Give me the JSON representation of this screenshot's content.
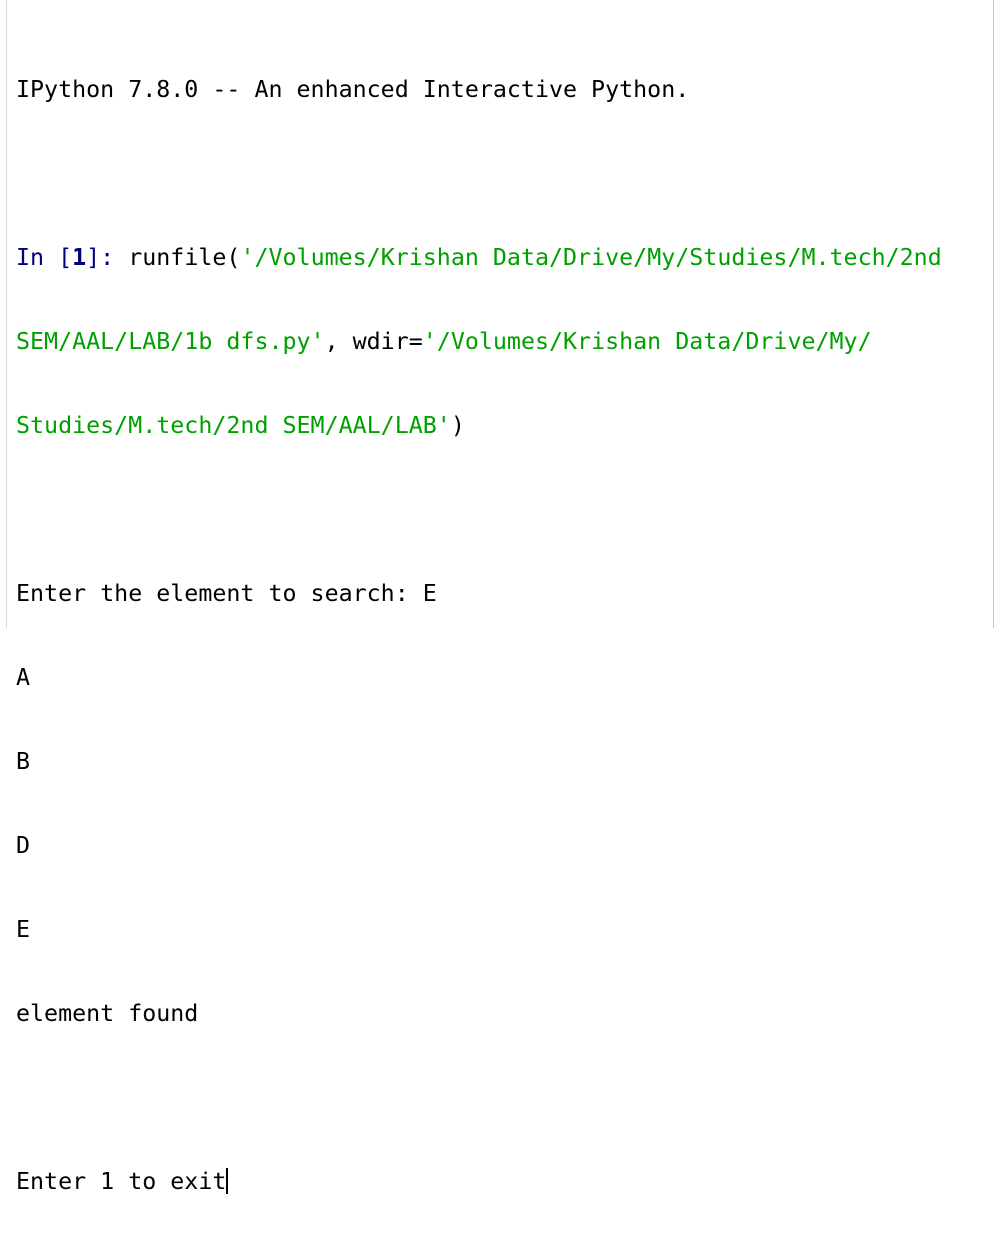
{
  "banner": "IPython 7.8.0 -- An enhanced Interactive Python.",
  "input": {
    "prompt_prefix": "In [",
    "prompt_number": "1",
    "prompt_suffix": "]: ",
    "line1_code": "runfile(",
    "line1_str": "'/Volumes/Krishan Data/Drive/My/Studies/M.tech/2nd",
    "line2_str": "SEM/AAL/LAB/1b dfs.py'",
    "line2_code": ", wdir=",
    "line2_str2": "'/Volumes/Krishan Data/Drive/My/",
    "line3_str": "Studies/M.tech/2nd SEM/AAL/LAB'",
    "line3_code": ")"
  },
  "output": [
    "Enter the element to search: E",
    "A",
    "B",
    "D",
    "E",
    "element found"
  ],
  "current_prompt": "Enter 1 to exit",
  "colors": {
    "prompt": "#000080",
    "string": "#00a000",
    "text": "#000000"
  }
}
